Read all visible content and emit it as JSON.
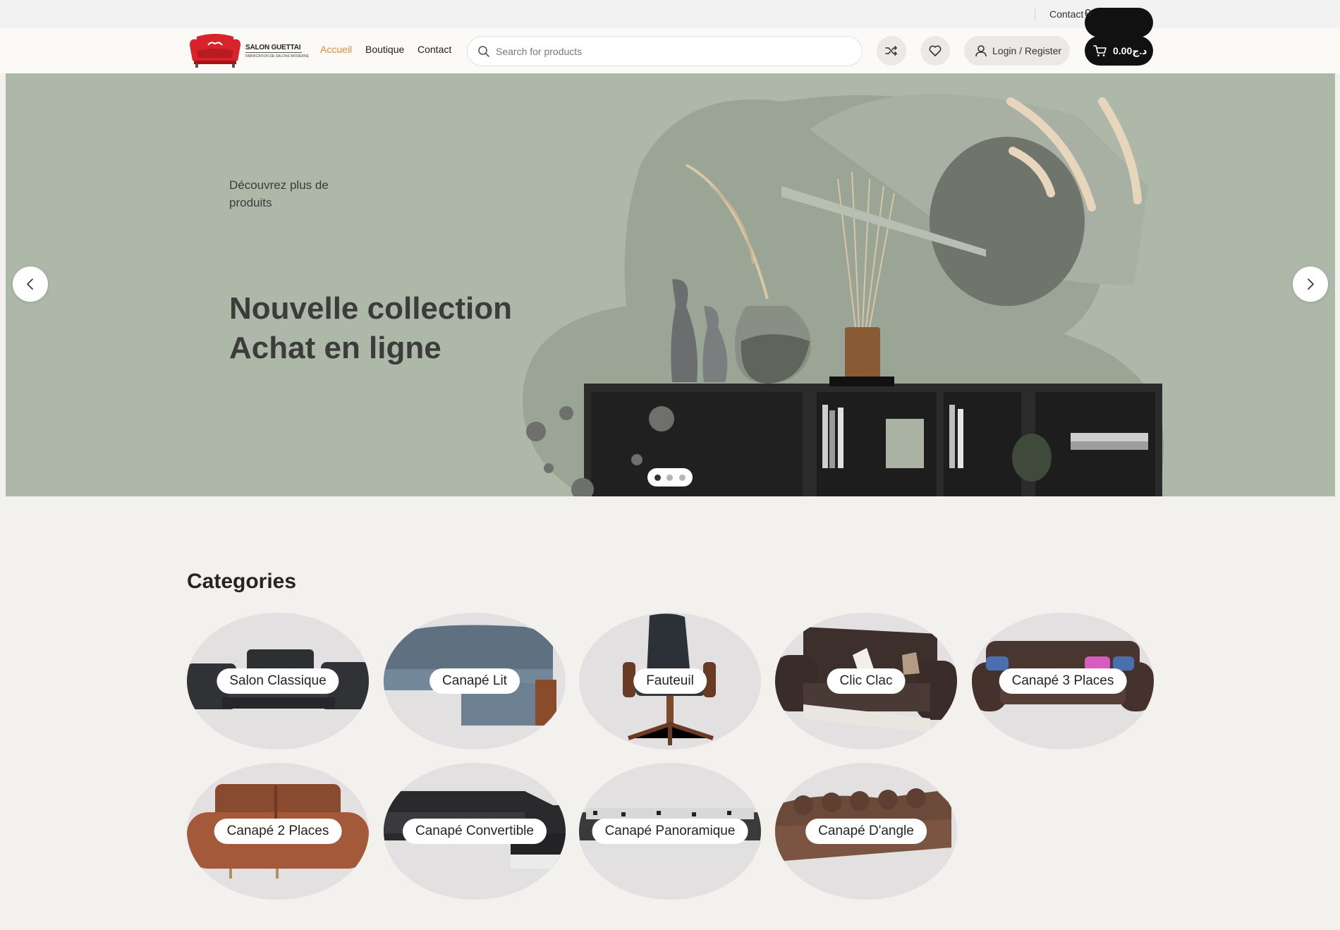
{
  "topbar": {
    "contact_label": "Contact with an expert"
  },
  "header": {
    "logo": {
      "line1": "SALON GUETTAI",
      "line2": "FABRICATION DE SALONS MODERNE"
    },
    "nav": [
      {
        "label": "Accueil",
        "active": true
      },
      {
        "label": "Boutique",
        "active": false
      },
      {
        "label": "Contact",
        "active": false
      }
    ],
    "search": {
      "placeholder": "Search for products",
      "value": ""
    },
    "icons": {
      "compare": "shuffle-icon",
      "wishlist": "heart-icon",
      "user": "user-icon",
      "cart": "cart-icon"
    },
    "login_label": "Login / Register",
    "cart": {
      "amount": "0.00د.ج",
      "count": "0"
    }
  },
  "hero": {
    "subtitle": "Découvrez plus de produits",
    "title_line1": "Nouvelle collection",
    "title_line2": "Achat en ligne",
    "slides_count": 3,
    "active_slide": 1,
    "background_color": "#aeb8a9"
  },
  "categories": {
    "title": "Categories",
    "items": [
      {
        "label": "Salon Classique",
        "image": "sofa-set"
      },
      {
        "label": "Canapé Lit",
        "image": "corner-sofa-bed"
      },
      {
        "label": "Fauteuil",
        "image": "office-chair"
      },
      {
        "label": "Clic Clac",
        "image": "clic-clac-sofa"
      },
      {
        "label": "Canapé 3 Places",
        "image": "three-seat-sofa"
      },
      {
        "label": "Canapé 2 Places",
        "image": "two-seat-sofa"
      },
      {
        "label": "Canapé Convertible",
        "image": "convertible-sofa"
      },
      {
        "label": "Canapé Panoramique",
        "image": "panoramic-sofa"
      },
      {
        "label": "Canapé D'angle",
        "image": "corner-sofa"
      }
    ]
  },
  "colors": {
    "accent": "#e8893c",
    "cart_bg": "#111111",
    "page_bg": "#f3f1ee"
  }
}
